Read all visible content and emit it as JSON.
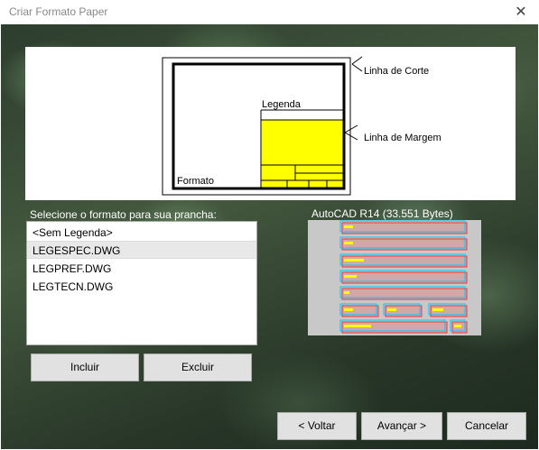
{
  "window": {
    "title": "Criar Formato Paper",
    "close_glyph": "✕"
  },
  "diagram": {
    "linha_corte": "Linha de Corte",
    "linha_margem": "Linha de Margem",
    "legenda": "Legenda",
    "formato": "Formato"
  },
  "list": {
    "label": "Selecione o formato para sua prancha:",
    "items": [
      "<Sem Legenda>",
      "LEGESPEC.DWG",
      "LEGPREF.DWG",
      "LEGTECN.DWG"
    ],
    "selected_index": 1
  },
  "preview": {
    "label": "AutoCAD R14 (33.551 Bytes)"
  },
  "buttons": {
    "incluir": "Incluir",
    "excluir": "Excluir",
    "voltar": "< Voltar",
    "avancar": "Avançar >",
    "cancelar": "Cancelar"
  },
  "colors": {
    "legend_fill": "#ffff00",
    "accent": "#0078d7"
  }
}
